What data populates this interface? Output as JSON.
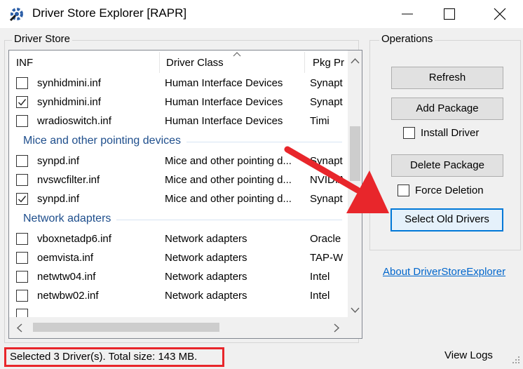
{
  "window": {
    "title": "Driver Store Explorer [RAPR]",
    "app_icon": "gear-wrench-icon",
    "controls": [
      "minimize-icon",
      "maximize-icon",
      "close-icon"
    ]
  },
  "driver_store": {
    "label": "Driver Store",
    "columns": [
      "INF",
      "Driver Class",
      "Pkg Pr"
    ],
    "sort_indicator": "sort-ascending-icon",
    "rows": [
      {
        "type": "row",
        "checked": false,
        "inf": "synhidmini.inf",
        "class": "Human Interface Devices",
        "pkg": "Synapt"
      },
      {
        "type": "row",
        "checked": true,
        "inf": "synhidmini.inf",
        "class": "Human Interface Devices",
        "pkg": "Synapt"
      },
      {
        "type": "row",
        "checked": false,
        "inf": "wradioswitch.inf",
        "class": "Human Interface Devices",
        "pkg": "Timi"
      },
      {
        "type": "group",
        "label": "Mice and other pointing devices"
      },
      {
        "type": "row",
        "checked": false,
        "inf": "synpd.inf",
        "class": "Mice and other pointing d...",
        "pkg": "Synapt"
      },
      {
        "type": "row",
        "checked": false,
        "inf": "nvswcfilter.inf",
        "class": "Mice and other pointing d...",
        "pkg": "NVIDIA"
      },
      {
        "type": "row",
        "checked": true,
        "inf": "synpd.inf",
        "class": "Mice and other pointing d...",
        "pkg": "Synapt"
      },
      {
        "type": "group",
        "label": "Network adapters"
      },
      {
        "type": "row",
        "checked": false,
        "inf": "vboxnetadp6.inf",
        "class": "Network adapters",
        "pkg": "Oracle"
      },
      {
        "type": "row",
        "checked": false,
        "inf": "oemvista.inf",
        "class": "Network adapters",
        "pkg": "TAP-W"
      },
      {
        "type": "row",
        "checked": false,
        "inf": "netwtw04.inf",
        "class": "Network adapters",
        "pkg": "Intel"
      },
      {
        "type": "row",
        "checked": false,
        "inf": "netwbw02.inf",
        "class": "Network adapters",
        "pkg": "Intel"
      },
      {
        "type": "row",
        "checked": false,
        "inf": "",
        "class": "",
        "pkg": ""
      }
    ]
  },
  "operations": {
    "label": "Operations",
    "refresh": "Refresh",
    "add_package": "Add Package",
    "install_driver": "Install Driver",
    "install_driver_checked": false,
    "delete_package": "Delete Package",
    "force_deletion": "Force Deletion",
    "force_deletion_checked": false,
    "select_old_drivers": "Select Old Drivers"
  },
  "about_link": "About DriverStoreExplorer",
  "status": {
    "text": "Selected 3 Driver(s). Total size: 143 MB.",
    "view_logs": "View Logs"
  },
  "colors": {
    "annotation": "#e8262b",
    "group_header": "#1e4e8c",
    "link": "#0066cc",
    "focus": "#0078d7"
  }
}
